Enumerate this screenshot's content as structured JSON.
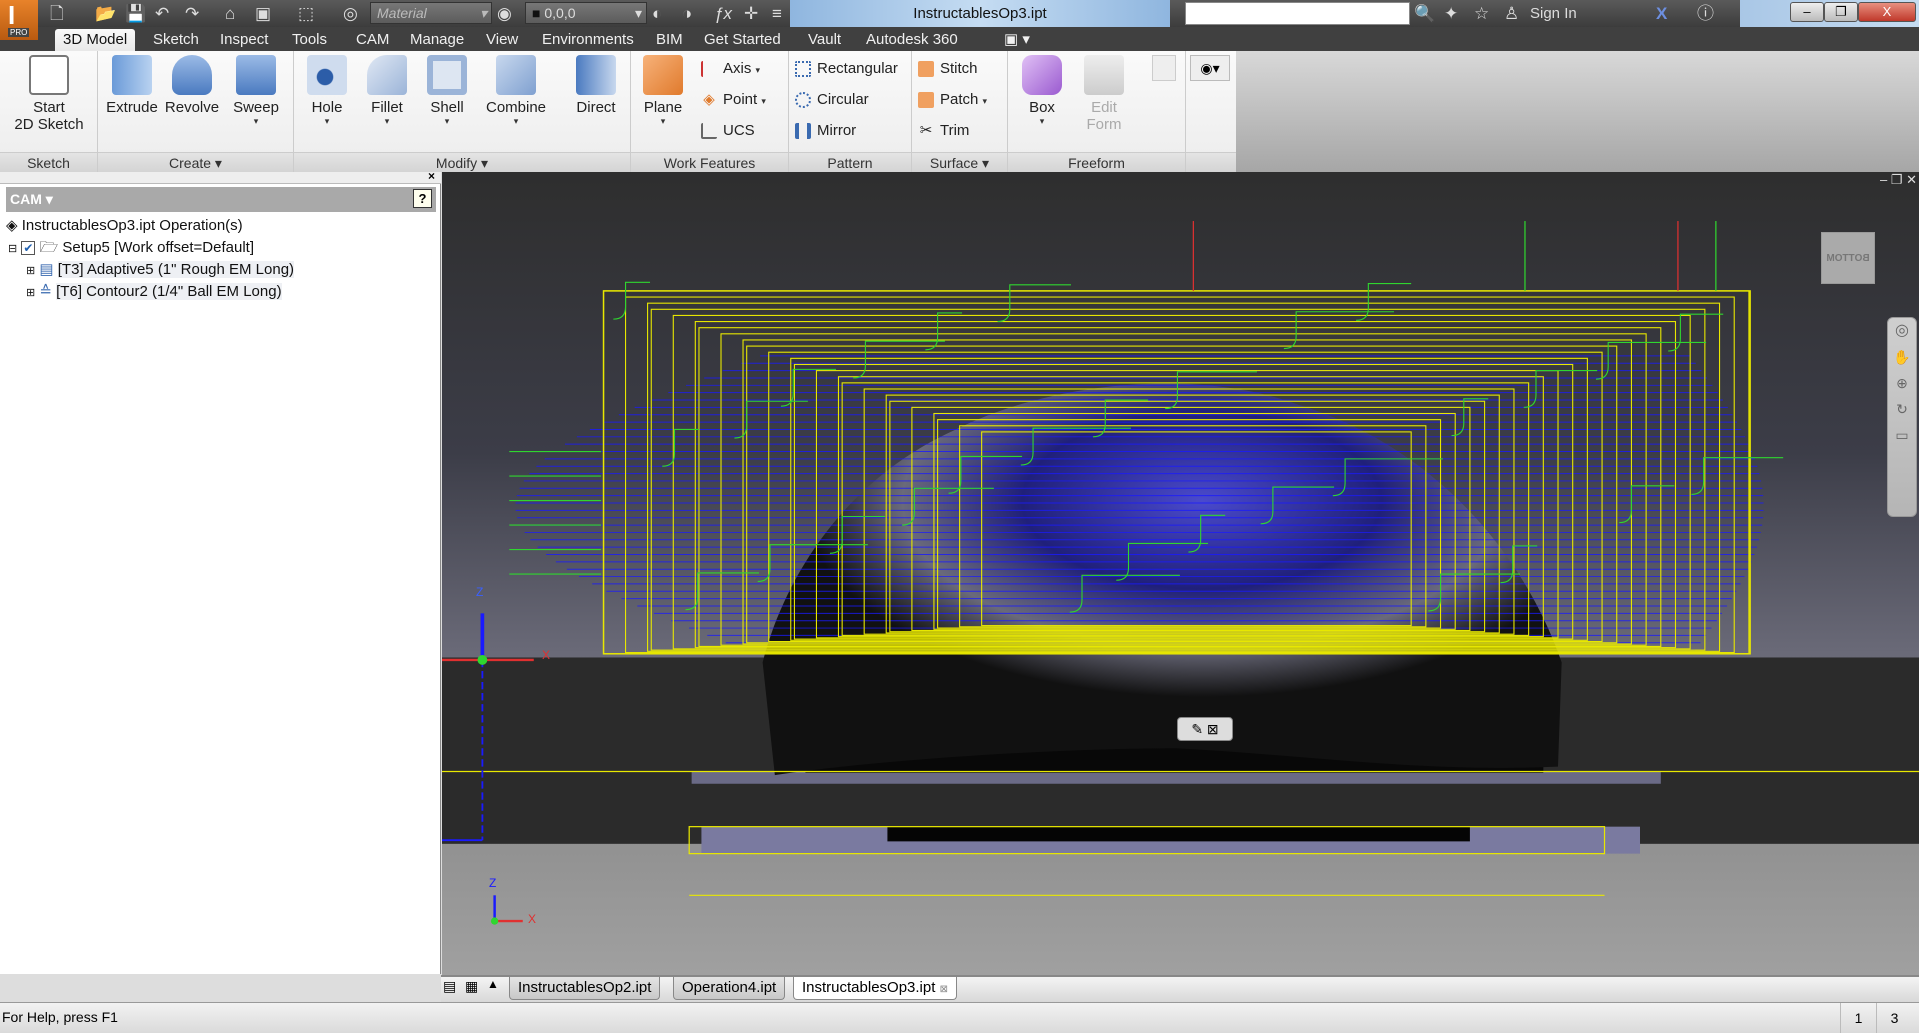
{
  "app": {
    "title": "InstructablesOp3.ipt",
    "badge": "PRO"
  },
  "quick_access": {
    "material": "Material",
    "appearance": "0,0,0",
    "sign_in": "Sign In",
    "search_value": ""
  },
  "ribbon_tabs": [
    "3D Model",
    "Sketch",
    "Inspect",
    "Tools",
    "CAM",
    "Manage",
    "View",
    "Environments",
    "BIM",
    "Get Started",
    "Vault",
    "Autodesk 360"
  ],
  "active_tab": "3D Model",
  "panels": {
    "sketch": {
      "title": "Sketch",
      "start": "Start",
      "start2": "2D Sketch"
    },
    "create": {
      "title": "Create",
      "extrude": "Extrude",
      "revolve": "Revolve",
      "sweep": "Sweep"
    },
    "modify": {
      "title": "Modify",
      "hole": "Hole",
      "fillet": "Fillet",
      "shell": "Shell",
      "combine": "Combine",
      "direct": "Direct"
    },
    "work_features": {
      "title": "Work Features",
      "plane": "Plane",
      "axis": "Axis",
      "point": "Point",
      "ucs": "UCS"
    },
    "pattern": {
      "title": "Pattern",
      "rectangular": "Rectangular",
      "circular": "Circular",
      "mirror": "Mirror"
    },
    "surface": {
      "title": "Surface",
      "stitch": "Stitch",
      "patch": "Patch",
      "trim": "Trim"
    },
    "freeform": {
      "title": "Freeform",
      "box": "Box",
      "edit": "Edit",
      "form": "Form"
    }
  },
  "browser": {
    "header": "CAM",
    "root": "InstructablesOp3.ipt Operation(s)",
    "setup": "Setup5 [Work offset=Default]",
    "setup_checked": true,
    "ops": [
      "[T3] Adaptive5 (1\" Rough EM Long)",
      "[T6] Contour2 (1/4\" Ball EM Long)"
    ]
  },
  "viewcube": {
    "face": "BOTTOM"
  },
  "axes": {
    "z": "Z",
    "x": "X"
  },
  "doc_tabs": [
    "InstructablesOp2.ipt",
    "Operation4.ipt",
    "InstructablesOp3.ipt"
  ],
  "active_doc": "InstructablesOp3.ipt",
  "status": {
    "help": "For Help, press F1",
    "count1": "1",
    "count2": "3"
  },
  "colors": {
    "toolpath_yellow": "#e8e800",
    "toolpath_green": "#2fd62f",
    "toolpath_blue": "#1a1aff",
    "model": "#2a2a8a"
  }
}
